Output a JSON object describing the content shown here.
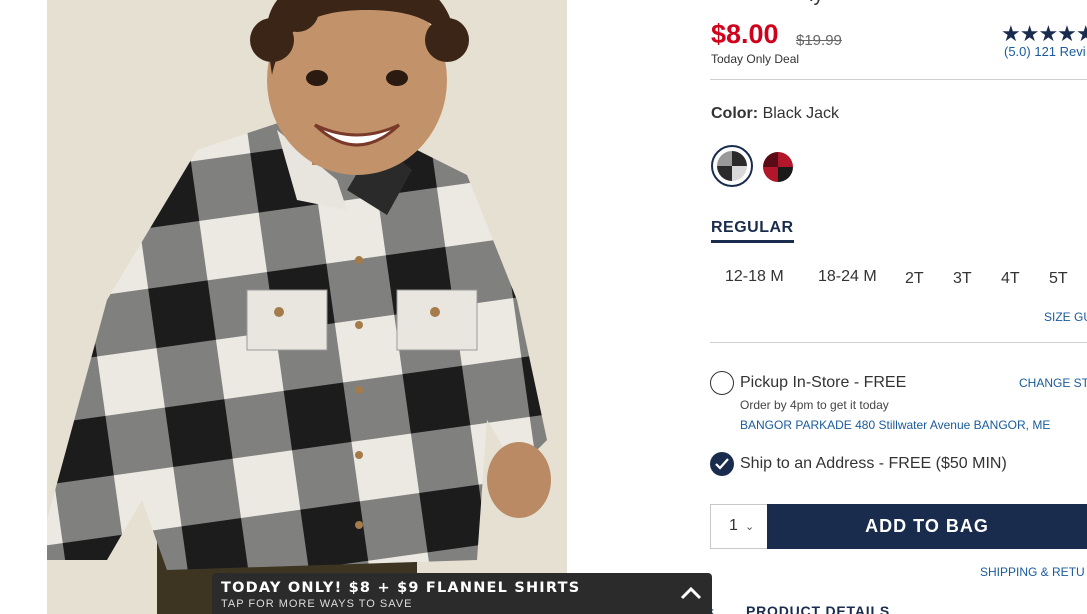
{
  "product": {
    "title_partial": "ly",
    "price": "$8.00",
    "original_price": "$19.99",
    "deal_note": "Today Only Deal",
    "rating_stars": "★★★★★",
    "reviews": "(5.0) 121 Revi"
  },
  "color": {
    "label": "Color:",
    "value": "Black Jack",
    "swatches": [
      {
        "name": "Black Jack",
        "colors": [
          "#2b2b2b",
          "#e6e6e6"
        ]
      },
      {
        "name": "Red Buffalo Plaid",
        "colors": [
          "#b2162a",
          "#1a1a1a"
        ]
      }
    ]
  },
  "fit": {
    "tab": "REGULAR"
  },
  "sizes": [
    "12-18 M",
    "18-24 M",
    "2T",
    "3T",
    "4T",
    "5T"
  ],
  "size_guide": "SIZE GU",
  "fulfillment": {
    "pickup_label": "Pickup In-Store - FREE",
    "change_store": "CHANGE ST",
    "pickup_note": "Order by 4pm to get it today",
    "store_address": "BANGOR PARKADE 480 Stillwater Avenue  BANGOR, ME",
    "ship_label": "Ship to an Address - FREE ($50 MIN)"
  },
  "quantity": {
    "value": "1"
  },
  "add_to_bag": "ADD TO BAG",
  "shipping_returns": "SHIPPING & RETU",
  "product_details": "PRODUCT DETAILS",
  "promo": {
    "title": "TODAY ONLY! $8 + $9 FLANNEL SHIRTS",
    "subtitle": "TAP FOR MORE WAYS TO SAVE"
  },
  "colors": {
    "sale_red": "#d0021b",
    "navy": "#1a2c4e",
    "link_blue": "#1a5b9c",
    "banner_dark": "#2b2b2b"
  }
}
